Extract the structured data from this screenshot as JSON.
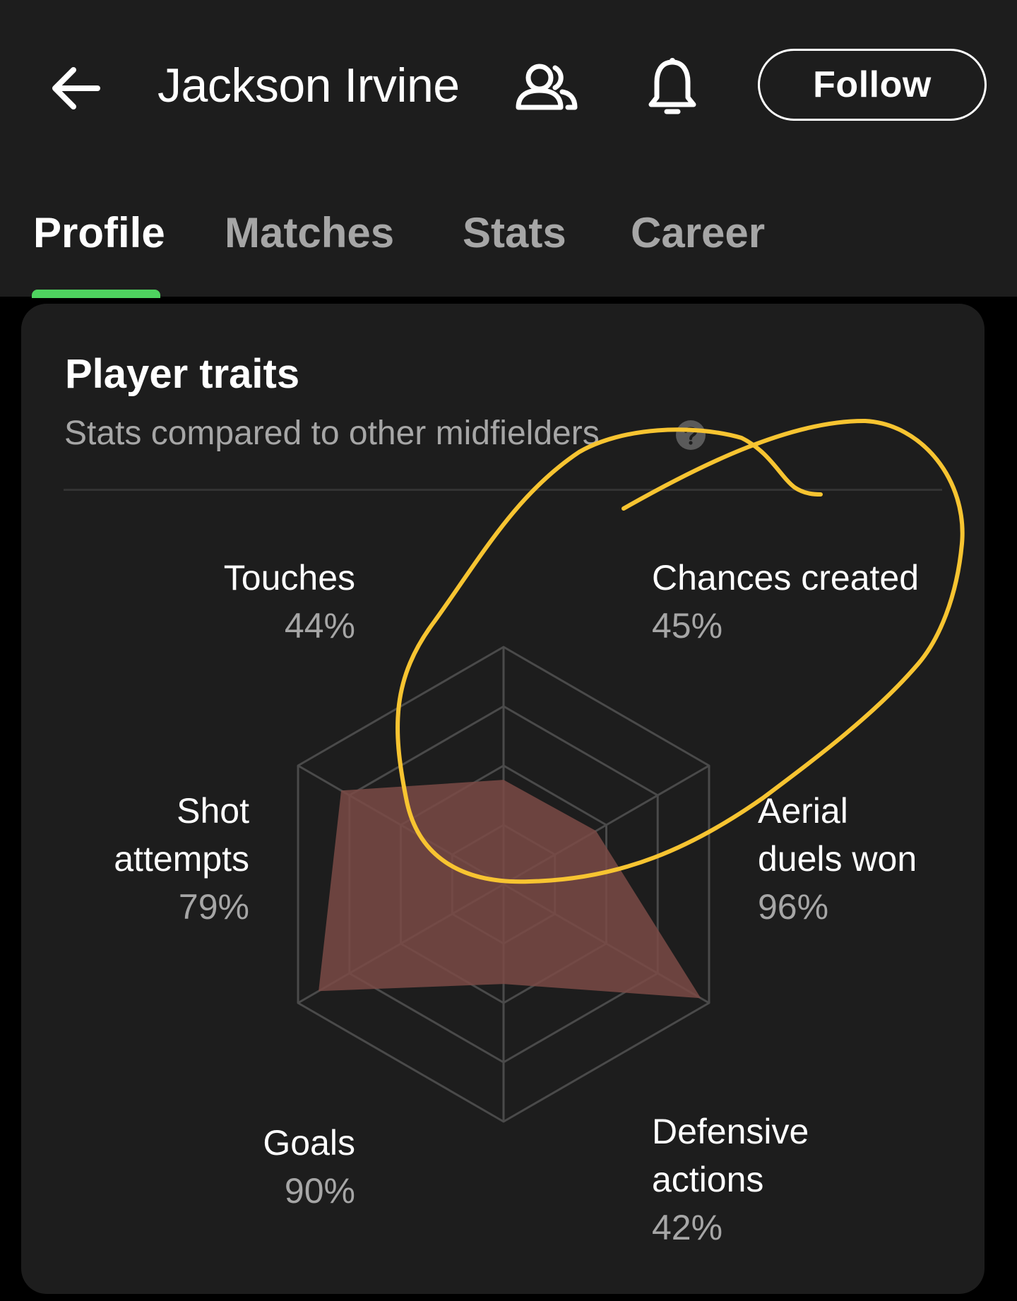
{
  "header": {
    "title": "Jackson Irvine",
    "follow_label": "Follow",
    "icons": [
      "back-arrow-icon",
      "people-icon",
      "bell-icon"
    ]
  },
  "tabs": [
    {
      "label": "Profile",
      "active": true
    },
    {
      "label": "Matches",
      "active": false
    },
    {
      "label": "Stats",
      "active": false
    },
    {
      "label": "Career",
      "active": false
    }
  ],
  "card": {
    "title": "Player traits",
    "subtitle": "Stats compared to other midfielders",
    "help_icon": "question-circle-icon"
  },
  "chart_data": {
    "type": "radar",
    "axes": [
      "Touches",
      "Chances created",
      "Aerial duels won",
      "Defensive actions",
      "Goals",
      "Shot attempts"
    ],
    "values": [
      0.44,
      0.45,
      0.96,
      0.42,
      0.9,
      0.79
    ],
    "value_labels": [
      "44%",
      "45%",
      "96%",
      "42%",
      "90%",
      "79%"
    ],
    "rings": 4,
    "fill_color": "#7a4a45"
  },
  "traits": [
    {
      "name": "Touches",
      "pct": "44%"
    },
    {
      "name": "Chances created",
      "pct": "45%"
    },
    {
      "name_line1": "Aerial",
      "name_line2": "duels won",
      "pct": "96%"
    },
    {
      "name_line1": "Defensive",
      "name_line2": "actions",
      "pct": "42%"
    },
    {
      "name": "Goals",
      "pct": "90%"
    },
    {
      "name_line1": "Shot",
      "name_line2": "attempts",
      "pct": "79%"
    }
  ],
  "colors": {
    "background": "#1d1d1d",
    "accent_tab": "#4ed35f",
    "annotation": "#f7c431",
    "muted_text": "#a6a6a6"
  }
}
